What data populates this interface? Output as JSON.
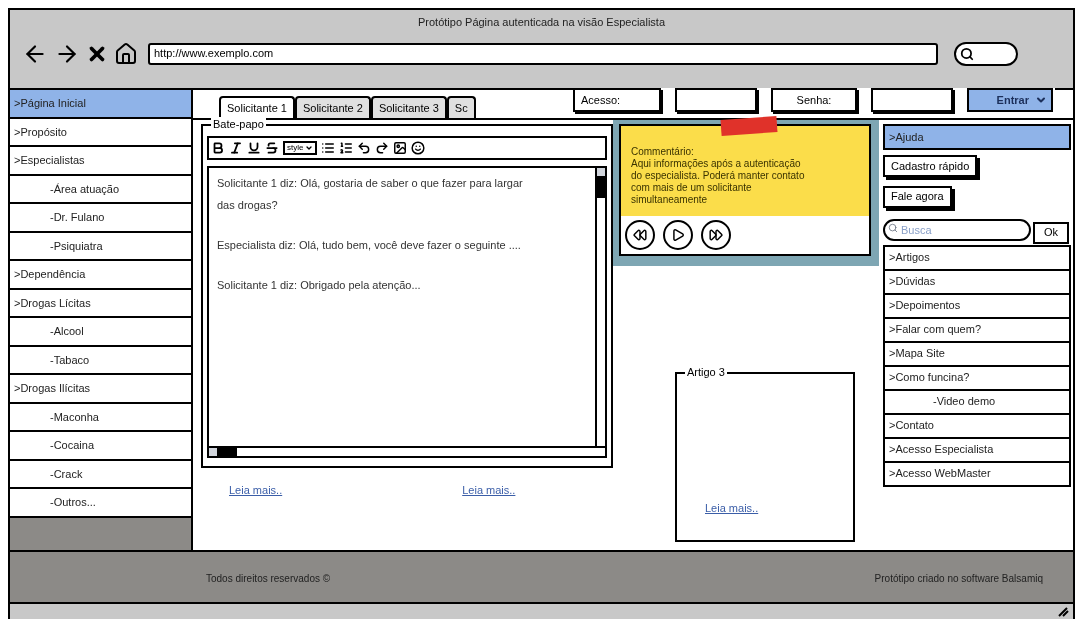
{
  "window": {
    "title": "Protótipo Página autenticada na visão Especialista"
  },
  "browser": {
    "url": "http://www.exemplo.com"
  },
  "left_menu": [
    {
      "label": ">Página Inicial",
      "selected": true
    },
    {
      "label": ">Propósito",
      "selected": false
    },
    {
      "label": ">Especialistas",
      "selected": false,
      "children": [
        {
          "label": "-Área atuação",
          "selected": false
        },
        {
          "label": "-Dr. Fulano",
          "selected": false
        },
        {
          "label": "-Psiquiatra",
          "selected": false
        }
      ]
    },
    {
      "label": ">Dependência",
      "selected": false
    },
    {
      "label": ">Drogas Lícitas",
      "selected": false,
      "children": [
        {
          "label": "-Alcool",
          "selected": false
        },
        {
          "label": "-Tabaco",
          "selected": false
        }
      ]
    },
    {
      "label": ">Drogas Ilícitas",
      "selected": false,
      "children": [
        {
          "label": "-Maconha",
          "selected": false
        },
        {
          "label": "-Cocaina",
          "selected": false
        },
        {
          "label": "-Crack",
          "selected": false
        },
        {
          "label": "-Outros...",
          "selected": false
        }
      ]
    }
  ],
  "tabs": [
    {
      "label": "Solicitante 1",
      "selected": true
    },
    {
      "label": "Solicitante 2",
      "selected": false
    },
    {
      "label": "Solicitante 3",
      "selected": false
    },
    {
      "label": "Sc",
      "selected": false
    }
  ],
  "login": {
    "user_label": "Acesso:",
    "password_label": "Senha:",
    "button": "Entrar"
  },
  "chat": {
    "title": "Bate-papo",
    "style_dropdown": "style",
    "messages": [
      "Solicitante 1 diz: Olá, gostaria de saber o que fazer para largar das drogas?",
      "Especialista diz: Olá, tudo bem, você deve fazer o seguinte ....",
      "Solicitante 1 diz: Obrigado pela atenção..."
    ]
  },
  "note": {
    "text": "Commentário:\nAqui informações após a autenticação\ndo especialista. Poderá manter contato\ncom mais de um solicitante simultaneamente"
  },
  "links": [
    "Leia mais..",
    "Leia mais.."
  ],
  "article": {
    "title": "Artigo 3",
    "link": "Leia mais.."
  },
  "right_menu": [
    {
      "kind": "item",
      "label": ">Ajuda",
      "selected": true
    },
    {
      "kind": "button",
      "label": "Cadastro rápido"
    },
    {
      "kind": "button",
      "label": "Fale agora"
    },
    {
      "kind": "search",
      "placeholder": "Busca",
      "button": "Ok"
    },
    {
      "kind": "item",
      "label": ">Artigos",
      "selected": false
    },
    {
      "kind": "item",
      "label": ">Dúvidas",
      "selected": false
    },
    {
      "kind": "item",
      "label": ">Depoimentos",
      "selected": false
    },
    {
      "kind": "item",
      "label": ">Falar com quem?",
      "selected": false
    },
    {
      "kind": "item",
      "label": ">Mapa Site",
      "selected": false
    },
    {
      "kind": "item",
      "label": ">Como funcina?",
      "selected": false,
      "children": [
        {
          "label": "-Video demo",
          "selected": false
        }
      ]
    },
    {
      "kind": "item",
      "label": ">Contato",
      "selected": false
    },
    {
      "kind": "item",
      "label": ">Acesso Especialista",
      "selected": false
    },
    {
      "kind": "item",
      "label": ">Acesso WebMaster",
      "selected": false
    }
  ],
  "footer": {
    "left": "Todos direitos reservados ©",
    "right": "Protótipo criado no software Balsamiq"
  }
}
